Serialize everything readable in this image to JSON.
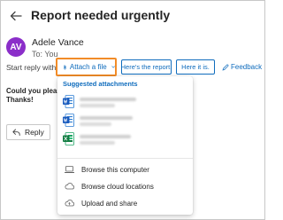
{
  "header": {
    "subject": "Report needed urgently"
  },
  "sender": {
    "initials": "AV",
    "name": "Adele Vance",
    "to": "To: You"
  },
  "suggested_replies": {
    "label": "Start reply with:",
    "attach_button": "Attach a file",
    "options": [
      "Here's the report.",
      "Here it is."
    ],
    "feedback": "Feedback"
  },
  "message": {
    "line1": "Could you please",
    "line2": "Thanks!"
  },
  "reply_button": "Reply",
  "attach_menu": {
    "header": "Suggested attachments",
    "files": [
      {
        "type": "word",
        "icon": "word-file-icon"
      },
      {
        "type": "word",
        "icon": "word-file-icon"
      },
      {
        "type": "excel",
        "icon": "excel-file-icon"
      }
    ],
    "actions": [
      {
        "label": "Browse this computer",
        "icon": "laptop-icon"
      },
      {
        "label": "Browse cloud locations",
        "icon": "cloud-icon"
      },
      {
        "label": "Upload and share",
        "icon": "cloud-upload-icon"
      }
    ]
  },
  "colors": {
    "accent": "#0f6cbd",
    "avatar": "#8b2ec9",
    "focus_outline": "#f28c28",
    "word": "#185abd",
    "excel": "#107c41"
  }
}
